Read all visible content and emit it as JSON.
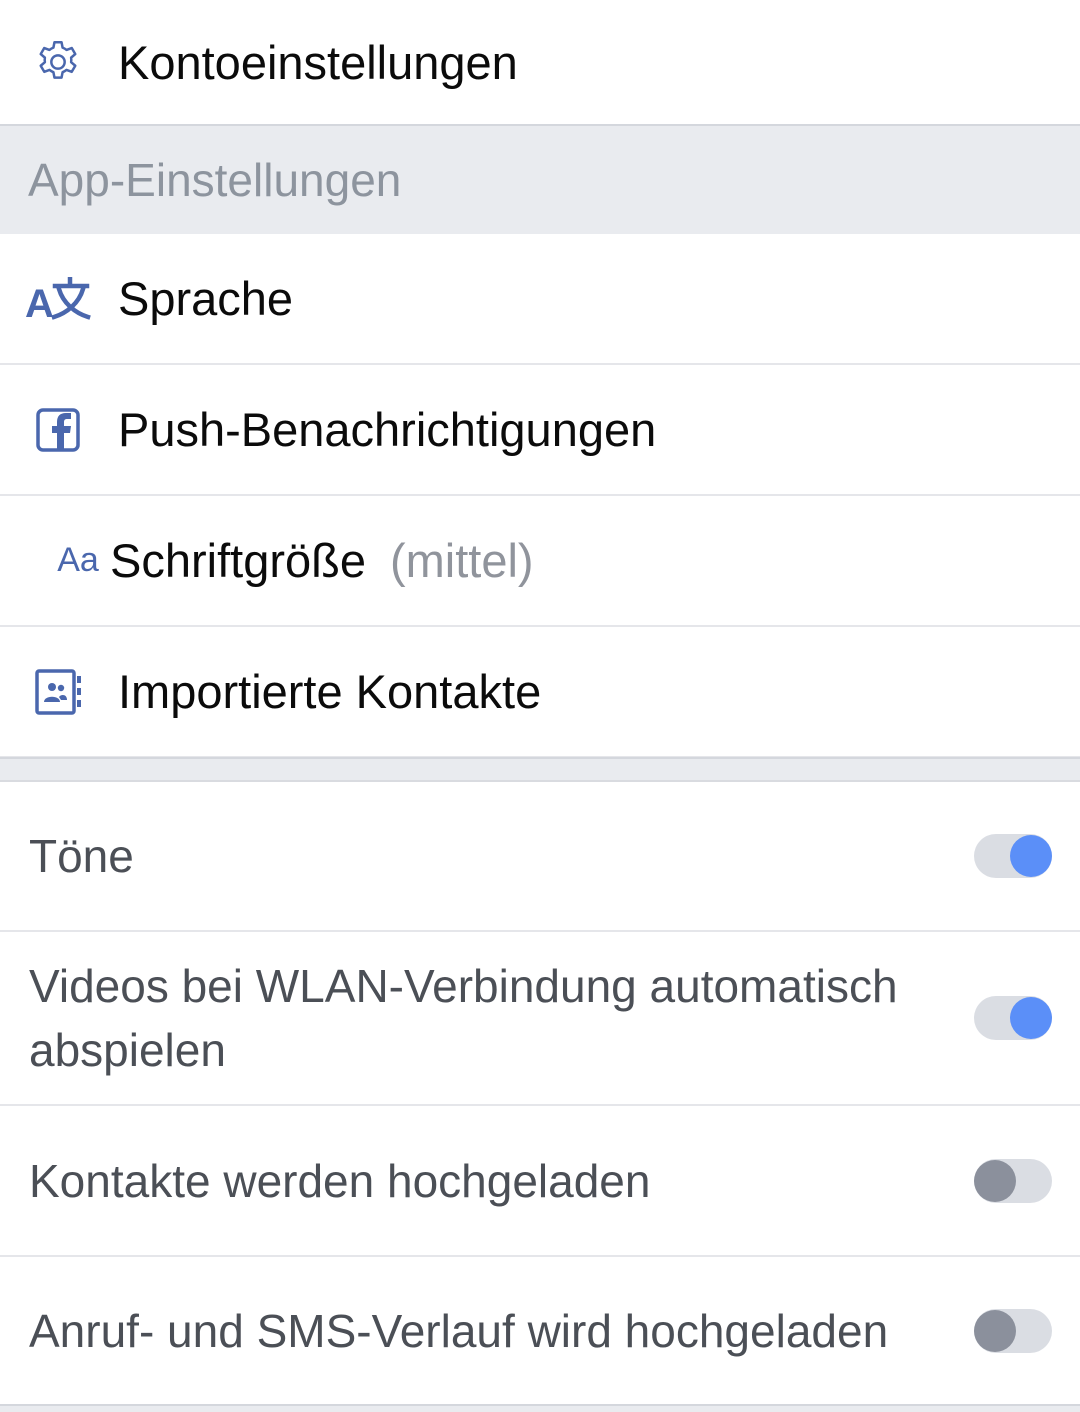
{
  "settings_menu": {
    "account_settings_label": "Kontoeinstellungen",
    "app_settings_header": "App-Einstellungen",
    "language_label": "Sprache",
    "push_notifications_label": "Push-Benachrichtigungen",
    "font_size_label": "Schriftgröße",
    "font_size_value": "(mittel)",
    "imported_contacts_label": "Importierte Kontakte"
  },
  "toggles": [
    {
      "label": "Töne",
      "enabled": true
    },
    {
      "label": "Videos bei WLAN-Verbindung automatisch abspielen",
      "enabled": true
    },
    {
      "label": "Kontakte werden hochgeladen",
      "enabled": false
    },
    {
      "label": "Anruf- und SMS-Verlauf wird hochgeladen",
      "enabled": false
    }
  ],
  "icons": {
    "account_settings": "gear-icon",
    "language": "translate-icon",
    "push_notifications": "facebook-icon",
    "font_size": "font-size-icon",
    "font_size_glyph": "Aa",
    "imported_contacts": "contacts-book-icon"
  },
  "colors": {
    "icon_blue": "#4a67ad",
    "toggle_on": "#5b8ff8",
    "toggle_off": "#8b909c",
    "section_background": "#e9ebef"
  }
}
